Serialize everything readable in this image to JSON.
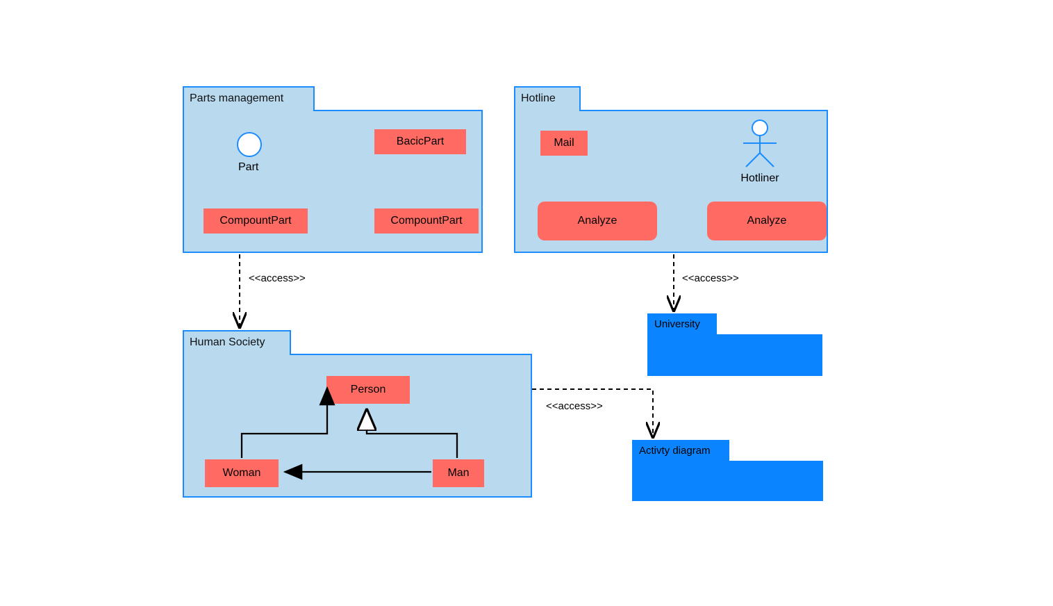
{
  "packages": {
    "parts_management": {
      "title": "Parts management",
      "part_label": "Part",
      "basic_part": "BacicPart",
      "compount_part_1": "CompountPart",
      "compount_part_2": "CompountPart"
    },
    "hotline": {
      "title": "Hotline",
      "mail": "Mail",
      "actor": "Hotliner",
      "analyze_1": "Analyze",
      "analyze_2": "Analyze"
    },
    "human_society": {
      "title": "Human Society",
      "person": "Person",
      "woman": "Woman",
      "man": "Man"
    },
    "university": {
      "title": "University"
    },
    "activity": {
      "title": "Activty diagram"
    }
  },
  "connections": {
    "access_1": "<<access>>",
    "access_2": "<<access>>",
    "access_3": "<<access>>"
  }
}
